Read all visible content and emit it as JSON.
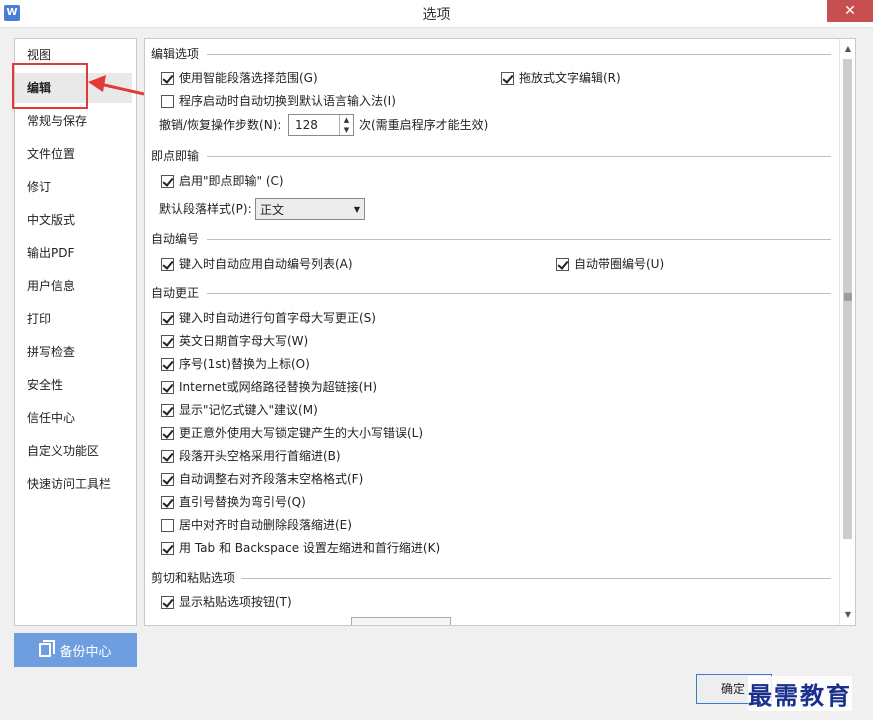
{
  "window": {
    "title": "选项",
    "app_icon": "W",
    "close": "✕"
  },
  "sidebar": {
    "items": [
      {
        "label": "视图"
      },
      {
        "label": "编辑"
      },
      {
        "label": "常规与保存"
      },
      {
        "label": "文件位置"
      },
      {
        "label": "修订"
      },
      {
        "label": "中文版式"
      },
      {
        "label": "输出PDF"
      },
      {
        "label": "用户信息"
      },
      {
        "label": "打印"
      },
      {
        "label": "拼写检查"
      },
      {
        "label": "安全性"
      },
      {
        "label": "信任中心"
      },
      {
        "label": "自定义功能区"
      },
      {
        "label": "快速访问工具栏"
      }
    ],
    "selected": "编辑"
  },
  "backup": {
    "label": "备份中心"
  },
  "sections": {
    "edit": {
      "header": "编辑选项",
      "smart_para": {
        "label": "使用智能段落选择范围(G)",
        "checked": true
      },
      "drag_text": {
        "label": "拖放式文字编辑(R)",
        "checked": true
      },
      "auto_ime": {
        "label": "程序启动时自动切换到默认语言输入法(I)",
        "checked": false
      },
      "undo_label": "撤销/恢复操作步数(N):",
      "undo_value": "128",
      "undo_note": "次(需重启程序才能生效)"
    },
    "instant": {
      "header": "即点即输",
      "enable": {
        "label": "启用\"即点即输\" (C)",
        "checked": true
      },
      "default_style_label": "默认段落样式(P):",
      "default_style_value": "正文"
    },
    "autonum": {
      "header": "自动编号",
      "auto_list": {
        "label": "键入时自动应用自动编号列表(A)",
        "checked": true
      },
      "auto_circle": {
        "label": "自动带圈编号(U)",
        "checked": true
      }
    },
    "autocorrect": {
      "header": "自动更正",
      "items": [
        {
          "label": "键入时自动进行句首字母大写更正(S)",
          "checked": true
        },
        {
          "label": "英文日期首字母大写(W)",
          "checked": true
        },
        {
          "label": "序号(1st)替换为上标(O)",
          "checked": true
        },
        {
          "label": "Internet或网络路径替换为超链接(H)",
          "checked": true
        },
        {
          "label": "显示\"记忆式键入\"建议(M)",
          "checked": true
        },
        {
          "label": "更正意外使用大写锁定键产生的大小写错误(L)",
          "checked": true
        },
        {
          "label": "段落开头空格采用行首缩进(B)",
          "checked": true
        },
        {
          "label": "自动调整右对齐段落末空格格式(F)",
          "checked": true
        },
        {
          "label": "直引号替换为弯引号(Q)",
          "checked": true
        },
        {
          "label": "居中对齐时自动删除段落缩进(E)",
          "checked": false
        },
        {
          "label": "用 Tab 和 Backspace 设置左缩进和首行缩进(K)",
          "checked": true
        }
      ]
    },
    "paste": {
      "header": "剪切和粘贴选项",
      "show_btn": {
        "label": "显示粘贴选项按钮(T)",
        "checked": true
      }
    }
  },
  "footer": {
    "ok": "确定"
  },
  "watermark": "最需教育",
  "colors": {
    "highlight": "#e23a3a",
    "backup_btn": "#6f9ee0",
    "close_btn": "#c74f4f"
  }
}
